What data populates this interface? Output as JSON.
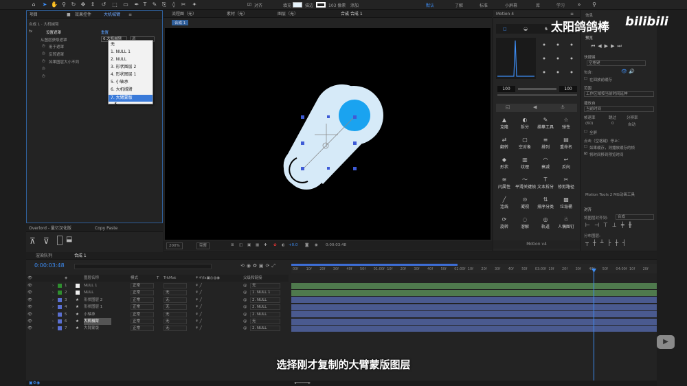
{
  "app": {
    "toolbar": {
      "align_label": "对齐",
      "fill_label": "填充",
      "stroke_label": "描边",
      "stroke_px": "103 像素",
      "add_label": "添加",
      "workspaces": [
        "默认",
        "了解",
        "标准",
        "小屏幕",
        "库",
        "学习"
      ]
    },
    "watermark": {
      "channel": "太阳鸽鸽棒",
      "logo": "bilibili"
    },
    "subtitle": "选择刚才复制的大臂蒙版图层"
  },
  "project_panel": {
    "tab_project": "项目",
    "tab_effects": "效果控件",
    "effects_layer": "大机械臂",
    "breadcrumb": "合成 1 · 大机械臂",
    "effect_name": "设置遮罩",
    "reset_label": "重置",
    "from_layer_label": "从图层获取遮罩",
    "from_layer_value": "6.大机械臂",
    "source_label": "源",
    "options": [
      "用于遮罩",
      "反转遮罩",
      "如果图层大小不同",
      "",
      ""
    ],
    "menu_items": [
      {
        "label": "无",
        "selected": false
      },
      {
        "label": "1. NULL 1",
        "selected": false
      },
      {
        "label": "2. NULL",
        "selected": false
      },
      {
        "label": "3. 形状图层 2",
        "selected": false
      },
      {
        "label": "4. 形状图层 1",
        "selected": false
      },
      {
        "label": "5. 小轴承",
        "selected": false
      },
      {
        "label": "6. 大机械臂",
        "selected": false,
        "bullet": true
      },
      {
        "label": "7. 大臂蒙版",
        "selected": true
      }
    ]
  },
  "overlord": {
    "tab": "Overlord - 量亿汉化版",
    "tab2": "Copy Paste"
  },
  "viewer": {
    "tabs": [
      "流程图（无）",
      "素材（无）",
      "图层（无）",
      "合成 合成 1"
    ],
    "comp_tab": "合成 1",
    "zoom": "200%",
    "quality": "完整",
    "exposure": "+0.0",
    "timecode": "0:00:03:48"
  },
  "motion": {
    "title": "Motion 4",
    "slider_left": "100",
    "slider_right": "100",
    "buttons": [
      "克隆",
      "拆分",
      "描摹工具",
      "弹性",
      "翻转",
      "空对象",
      "排列",
      "重命名",
      "形状",
      "纹理",
      "衰减",
      "反向",
      "闪属性",
      "平滑关键帧",
      "文本拆分",
      "修剪路径",
      "连线",
      "凝视",
      "排序分类",
      "垃圾桶",
      "旋转",
      "溶解",
      "轨道",
      "人偶图钉"
    ],
    "footer": "Motion v4"
  },
  "right_panel": {
    "tab_info": "信息",
    "preview": "预览",
    "shortcut_label": "快捷键",
    "shortcut_value": "空格键",
    "include_label": "包含:",
    "cache_label": "在回放前缓存",
    "range_label": "范围",
    "range_value": "工作区域按当前时间延伸",
    "play_from_label": "播放自",
    "play_from_value": "当前时间",
    "fps_label": "帧速率",
    "skip_label": "跳过",
    "res_label": "分辨率",
    "fps_value": "(60)",
    "skip_value": "0",
    "res_value": "自动",
    "fullscreen": "全屏",
    "stop_note": "点击（空格键）停止：",
    "cache_note": "如果缓存，则播放缓存的帧",
    "move_note": "将时间移到预览时间",
    "mg_tools": "Motion Tools 2 MG动画工具",
    "align_title": "对齐",
    "align_to_label": "将图层对齐到:",
    "align_to_value": "合成",
    "distribute": "分布图层:"
  },
  "timeline": {
    "tab_render": "渲染队列",
    "tab_comp": "合成 1",
    "timecode": "0:00:03:48",
    "headers": {
      "name": "图层名称",
      "mode": "模式",
      "t": "T",
      "trkmat": "TrkMat",
      "parent": "父级和链接"
    },
    "time_ticks": [
      "00f",
      "10f",
      "20f",
      "30f",
      "40f",
      "50f",
      "01:00f",
      "10f",
      "20f",
      "30f",
      "40f",
      "50f",
      "02:00f",
      "10f",
      "20f",
      "30f",
      "40f",
      "50f",
      "03:00f",
      "10f",
      "20f",
      "30f",
      "40f",
      "50f",
      "04:00f",
      "10f",
      "20f"
    ],
    "layers": [
      {
        "num": "1",
        "name": "NULL 1",
        "mode": "正常",
        "trkmat": "",
        "parent": "无",
        "label_color": "#2f8f2f",
        "type": "null",
        "bar_color": "#4f7a4d"
      },
      {
        "num": "2",
        "name": "NULL",
        "mode": "正常",
        "trkmat": "无",
        "parent": "1. NULL 1",
        "label_color": "#2f8f2f",
        "type": "null",
        "bar_color": "#4f7a4d"
      },
      {
        "num": "3",
        "name": "形状图层 2",
        "mode": "正常",
        "trkmat": "无",
        "parent": "2. NULL",
        "label_color": "#5a6fd0",
        "type": "shape",
        "bar_color": "#4a5a8f"
      },
      {
        "num": "4",
        "name": "形状图层 1",
        "mode": "正常",
        "trkmat": "无",
        "parent": "2. NULL",
        "label_color": "#5a6fd0",
        "type": "shape",
        "bar_color": "#4a5a8f"
      },
      {
        "num": "5",
        "name": "小轴承",
        "mode": "正常",
        "trkmat": "无",
        "parent": "2. NULL",
        "label_color": "#5a6fd0",
        "type": "shape",
        "bar_color": "#4a5a8f"
      },
      {
        "num": "6",
        "name": "大机械臂",
        "mode": "正常",
        "trkmat": "无",
        "parent": "无",
        "label_color": "#5a6fd0",
        "type": "shape",
        "bar_color": "#4a5a8f",
        "selected": true
      },
      {
        "num": "7",
        "name": "大臂蒙版",
        "mode": "正常",
        "trkmat": "无",
        "parent": "2. NULL",
        "label_color": "#5a6fd0",
        "type": "shape",
        "bar_color": "#4a5a8f"
      }
    ]
  },
  "colors": {
    "accent": "#3d8df5",
    "arm_fill": "#d6eaf8",
    "joint_blue": "#1aa3f0"
  }
}
